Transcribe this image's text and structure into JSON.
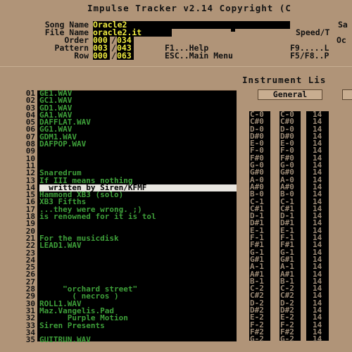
{
  "header": {
    "title": "Impulse Tracker v2.14 Copyright (C",
    "labels": {
      "song_name": "Song Name",
      "file_name": "File Name",
      "order": "Order",
      "pattern": "Pattern",
      "row": "Row"
    },
    "values": {
      "song_name": "Oracle2",
      "file_name": "oracle2.it",
      "order_cur": "000",
      "order_total": "034",
      "pattern_cur": "003",
      "pattern_total": "043",
      "row_cur": "000",
      "row_total": "063"
    },
    "keys": {
      "f1": "F1...Help",
      "esc": "ESC..Main Menu",
      "f9": "F9.....L",
      "f5f8": "F5/F8..P"
    },
    "right": {
      "sa": "Sa",
      "speed": "Speed/T",
      "oc": "Oc"
    }
  },
  "instrument_panel": {
    "title": "Instrument Lis",
    "tab_general": "General"
  },
  "instruments": [
    {
      "num": "01",
      "name": "GE1.WAV"
    },
    {
      "num": "02",
      "name": "GC1.WAV"
    },
    {
      "num": "03",
      "name": "GD1.WAV"
    },
    {
      "num": "04",
      "name": "GA1.WAV"
    },
    {
      "num": "05",
      "name": "DAFFLAT.WAV"
    },
    {
      "num": "06",
      "name": "GG1.WAV"
    },
    {
      "num": "07",
      "name": "GDM1.WAV"
    },
    {
      "num": "08",
      "name": "DAFPOP.WAV"
    },
    {
      "num": "09",
      "name": ""
    },
    {
      "num": "10",
      "name": ""
    },
    {
      "num": "11",
      "name": ""
    },
    {
      "num": "12",
      "name": "Snaredrum"
    },
    {
      "num": "13",
      "name": "If III means nothing"
    },
    {
      "num": "14",
      "name": "  written by Siren/KFMF"
    },
    {
      "num": "15",
      "name": "Hammond XB3 (solo)"
    },
    {
      "num": "16",
      "name": "XB3 Fifths"
    },
    {
      "num": "17",
      "name": "...they were wrong. ;)"
    },
    {
      "num": "18",
      "name": "is renowned for it is tol"
    },
    {
      "num": "19",
      "name": ""
    },
    {
      "num": "20",
      "name": ""
    },
    {
      "num": "21",
      "name": "For the musicdisk"
    },
    {
      "num": "22",
      "name": "LEAD1.WAV"
    },
    {
      "num": "23",
      "name": ""
    },
    {
      "num": "24",
      "name": ""
    },
    {
      "num": "25",
      "name": ""
    },
    {
      "num": "26",
      "name": ""
    },
    {
      "num": "27",
      "name": ""
    },
    {
      "num": "28",
      "name": "     \"orchard street\""
    },
    {
      "num": "29",
      "name": "       ( necros )"
    },
    {
      "num": "30",
      "name": "ROLL1.WAV"
    },
    {
      "num": "31",
      "name": "Maz.Vangelis.Pad"
    },
    {
      "num": "32",
      "name": "      Purple Motion"
    },
    {
      "num": "33",
      "name": "Siren Presents"
    },
    {
      "num": "34",
      "name": ""
    },
    {
      "num": "35",
      "name": "GUITRUN.WAV"
    }
  ],
  "note_table": [
    {
      "note": "C-0",
      "sample_note": "C-0",
      "sample": "14"
    },
    {
      "note": "C#0",
      "sample_note": "C#0",
      "sample": "14"
    },
    {
      "note": "D-0",
      "sample_note": "D-0",
      "sample": "14"
    },
    {
      "note": "D#0",
      "sample_note": "D#0",
      "sample": "14"
    },
    {
      "note": "E-0",
      "sample_note": "E-0",
      "sample": "14"
    },
    {
      "note": "F-0",
      "sample_note": "F-0",
      "sample": "14"
    },
    {
      "note": "F#0",
      "sample_note": "F#0",
      "sample": "14"
    },
    {
      "note": "G-0",
      "sample_note": "G-0",
      "sample": "14"
    },
    {
      "note": "G#0",
      "sample_note": "G#0",
      "sample": "14"
    },
    {
      "note": "A-0",
      "sample_note": "A-0",
      "sample": "14"
    },
    {
      "note": "A#0",
      "sample_note": "A#0",
      "sample": "14"
    },
    {
      "note": "B-0",
      "sample_note": "B-0",
      "sample": "14"
    },
    {
      "note": "C-1",
      "sample_note": "C-1",
      "sample": "14"
    },
    {
      "note": "C#1",
      "sample_note": "C#1",
      "sample": "14"
    },
    {
      "note": "D-1",
      "sample_note": "D-1",
      "sample": "14"
    },
    {
      "note": "D#1",
      "sample_note": "D#1",
      "sample": "14"
    },
    {
      "note": "E-1",
      "sample_note": "E-1",
      "sample": "14"
    },
    {
      "note": "F-1",
      "sample_note": "F-1",
      "sample": "14"
    },
    {
      "note": "F#1",
      "sample_note": "F#1",
      "sample": "14"
    },
    {
      "note": "G-1",
      "sample_note": "G-1",
      "sample": "14"
    },
    {
      "note": "G#1",
      "sample_note": "G#1",
      "sample": "14"
    },
    {
      "note": "A-1",
      "sample_note": "A-1",
      "sample": "14"
    },
    {
      "note": "A#1",
      "sample_note": "A#1",
      "sample": "14"
    },
    {
      "note": "B-1",
      "sample_note": "B-1",
      "sample": "14"
    },
    {
      "note": "C-2",
      "sample_note": "C-2",
      "sample": "14"
    },
    {
      "note": "C#2",
      "sample_note": "C#2",
      "sample": "14"
    },
    {
      "note": "D-2",
      "sample_note": "D-2",
      "sample": "14"
    },
    {
      "note": "D#2",
      "sample_note": "D#2",
      "sample": "14"
    },
    {
      "note": "E-2",
      "sample_note": "E-2",
      "sample": "14"
    },
    {
      "note": "F-2",
      "sample_note": "F-2",
      "sample": "14"
    },
    {
      "note": "F#2",
      "sample_note": "F#2",
      "sample": "14"
    },
    {
      "note": "G-2",
      "sample_note": "G-2",
      "sample": "14"
    }
  ],
  "selected_instrument_index": 13,
  "colors": {
    "background": "#b09478",
    "panel": "#000000",
    "instrument_text": "#3ea03a",
    "header_value": "#f0ec40",
    "selection": "#e9e6e0",
    "note_text": "#9a8874"
  }
}
